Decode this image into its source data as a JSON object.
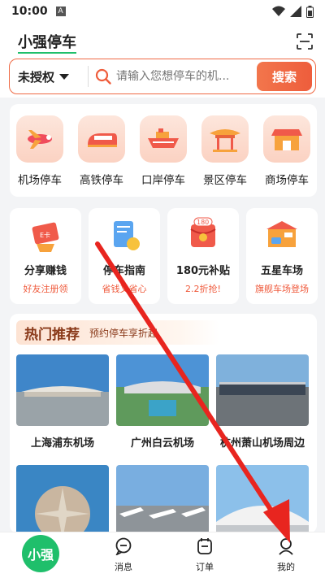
{
  "status": {
    "time": "10:00",
    "notif": "A"
  },
  "header": {
    "title": "小强停车"
  },
  "search": {
    "auth_label": "未授权",
    "placeholder": "请输入您想停车的机...",
    "button": "搜索"
  },
  "categories": [
    {
      "label": "机场停车",
      "icon": "airplane-icon"
    },
    {
      "label": "高铁停车",
      "icon": "train-icon"
    },
    {
      "label": "口岸停车",
      "icon": "ship-icon"
    },
    {
      "label": "景区停车",
      "icon": "pavilion-icon"
    },
    {
      "label": "商场停车",
      "icon": "mall-icon"
    }
  ],
  "promos": [
    {
      "title": "分享赚钱",
      "sub": "好友注册领",
      "icon": "gift-voucher-icon",
      "badge": "E卡"
    },
    {
      "title": "停车指南",
      "sub": "省钱又省心",
      "icon": "guide-icon"
    },
    {
      "title": "180元补贴",
      "sub": "2.2折抢!",
      "icon": "red-packet-icon",
      "badge": "180"
    },
    {
      "title": "五星车场",
      "sub": "旗舰车场登场",
      "icon": "parking-lot-icon"
    }
  ],
  "hot": {
    "title": "热门推荐",
    "subtitle": "预约停车享折起",
    "places": [
      {
        "name": "上海浦东机场"
      },
      {
        "name": "广州白云机场"
      },
      {
        "name": "杭州萧山机场周边"
      },
      {
        "name": ""
      },
      {
        "name": ""
      },
      {
        "name": ""
      }
    ]
  },
  "tabs": {
    "home": "小强",
    "messages": "消息",
    "orders": "订单",
    "mine": "我的"
  },
  "colors": {
    "accent": "#1fbf6b",
    "brand_orange": "#ef5d3c",
    "arrow": "#e8251f"
  }
}
